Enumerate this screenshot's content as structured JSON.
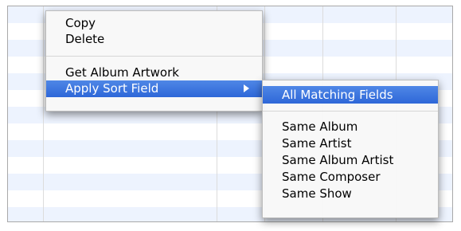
{
  "context_menu": {
    "items": {
      "copy": "Copy",
      "delete": "Delete",
      "get_album_artwork": "Get Album Artwork",
      "apply_sort_field": "Apply Sort Field"
    }
  },
  "submenu": {
    "items": {
      "all_matching_fields": "All Matching Fields",
      "same_album": "Same Album",
      "same_artist": "Same Artist",
      "same_album_artist": "Same Album Artist",
      "same_composer": "Same Composer",
      "same_show": "Same Show"
    }
  },
  "colors": {
    "highlight": "#3a74de",
    "row_stripe": "#edf3fe"
  },
  "icons": {
    "submenu_indicator": "triangle-right-icon"
  }
}
